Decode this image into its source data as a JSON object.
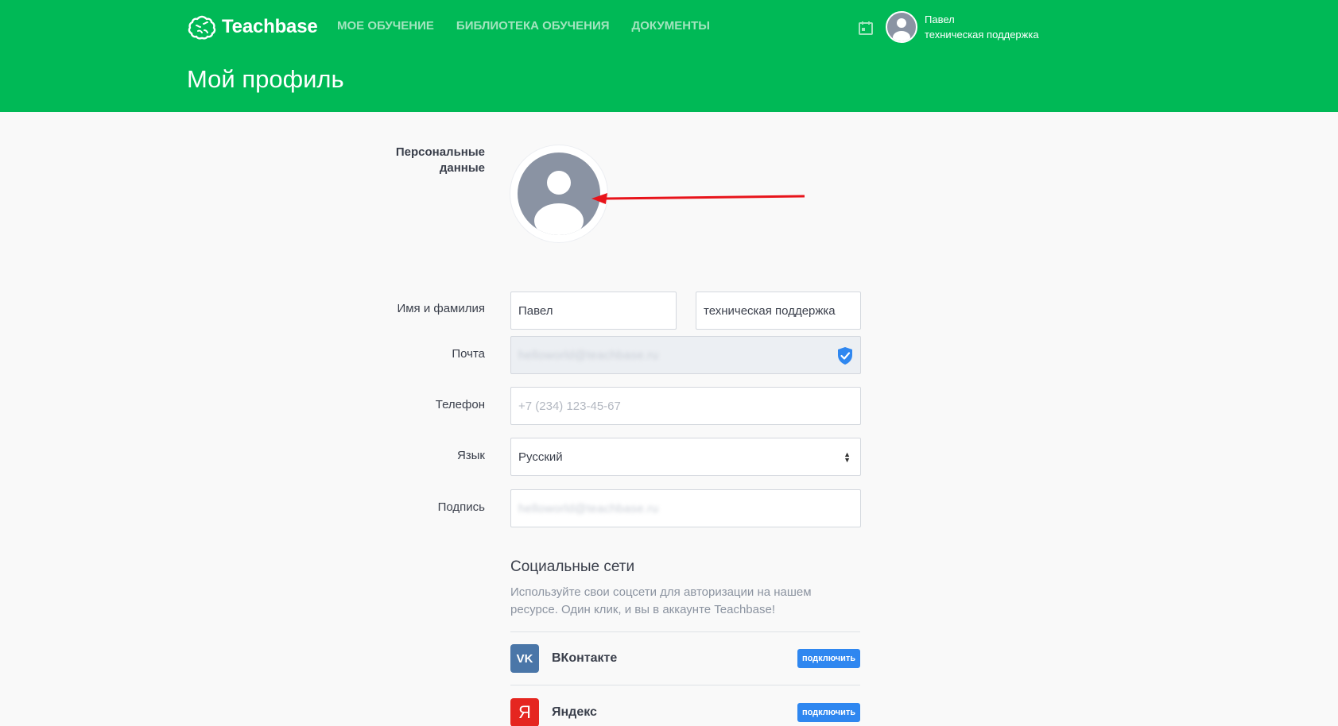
{
  "header": {
    "brand": "Teachbase",
    "nav": [
      {
        "label": "МОЕ ОБУЧЕНИЕ"
      },
      {
        "label": "БИБЛИОТЕКА ОБУЧЕНИЯ"
      },
      {
        "label": "ДОКУМЕНТЫ"
      }
    ],
    "user": {
      "first_name": "Павел",
      "last_name": "техническая поддержка"
    },
    "page_title": "Мой профиль"
  },
  "profile": {
    "section_label": "Персональные данные",
    "fields": {
      "name": {
        "label": "Имя и фамилия",
        "first_value": "Павел",
        "last_value": "техническая поддержка"
      },
      "email": {
        "label": "Почта",
        "value": "helloworld@teachbase.ru"
      },
      "phone": {
        "label": "Телефон",
        "placeholder": "+7 (234) 123-45-67"
      },
      "language": {
        "label": "Язык",
        "value": "Русский"
      },
      "signature": {
        "label": "Подпись",
        "value": "helloworld@teachbase.ru"
      }
    }
  },
  "social": {
    "title": "Социальные сети",
    "description": "Используйте свои соцсети для авторизации на нашем ресурсе. Один клик, и вы в аккаунте Teachbase!",
    "items": [
      {
        "name": "ВКонтакте",
        "icon": "vk-icon",
        "icon_glyph": "VK",
        "color": "#4a76a8",
        "button": "подключить"
      },
      {
        "name": "Яндекс",
        "icon": "yandex-icon",
        "icon_glyph": "Я",
        "color": "#e52620",
        "button": "подключить"
      }
    ]
  },
  "colors": {
    "header_green": "#00b956",
    "nav_inactive": "#a3e4bf",
    "button_blue": "#2f87f0",
    "arrow_red": "#e8141b",
    "avatar_gray": "#8a93a3"
  }
}
